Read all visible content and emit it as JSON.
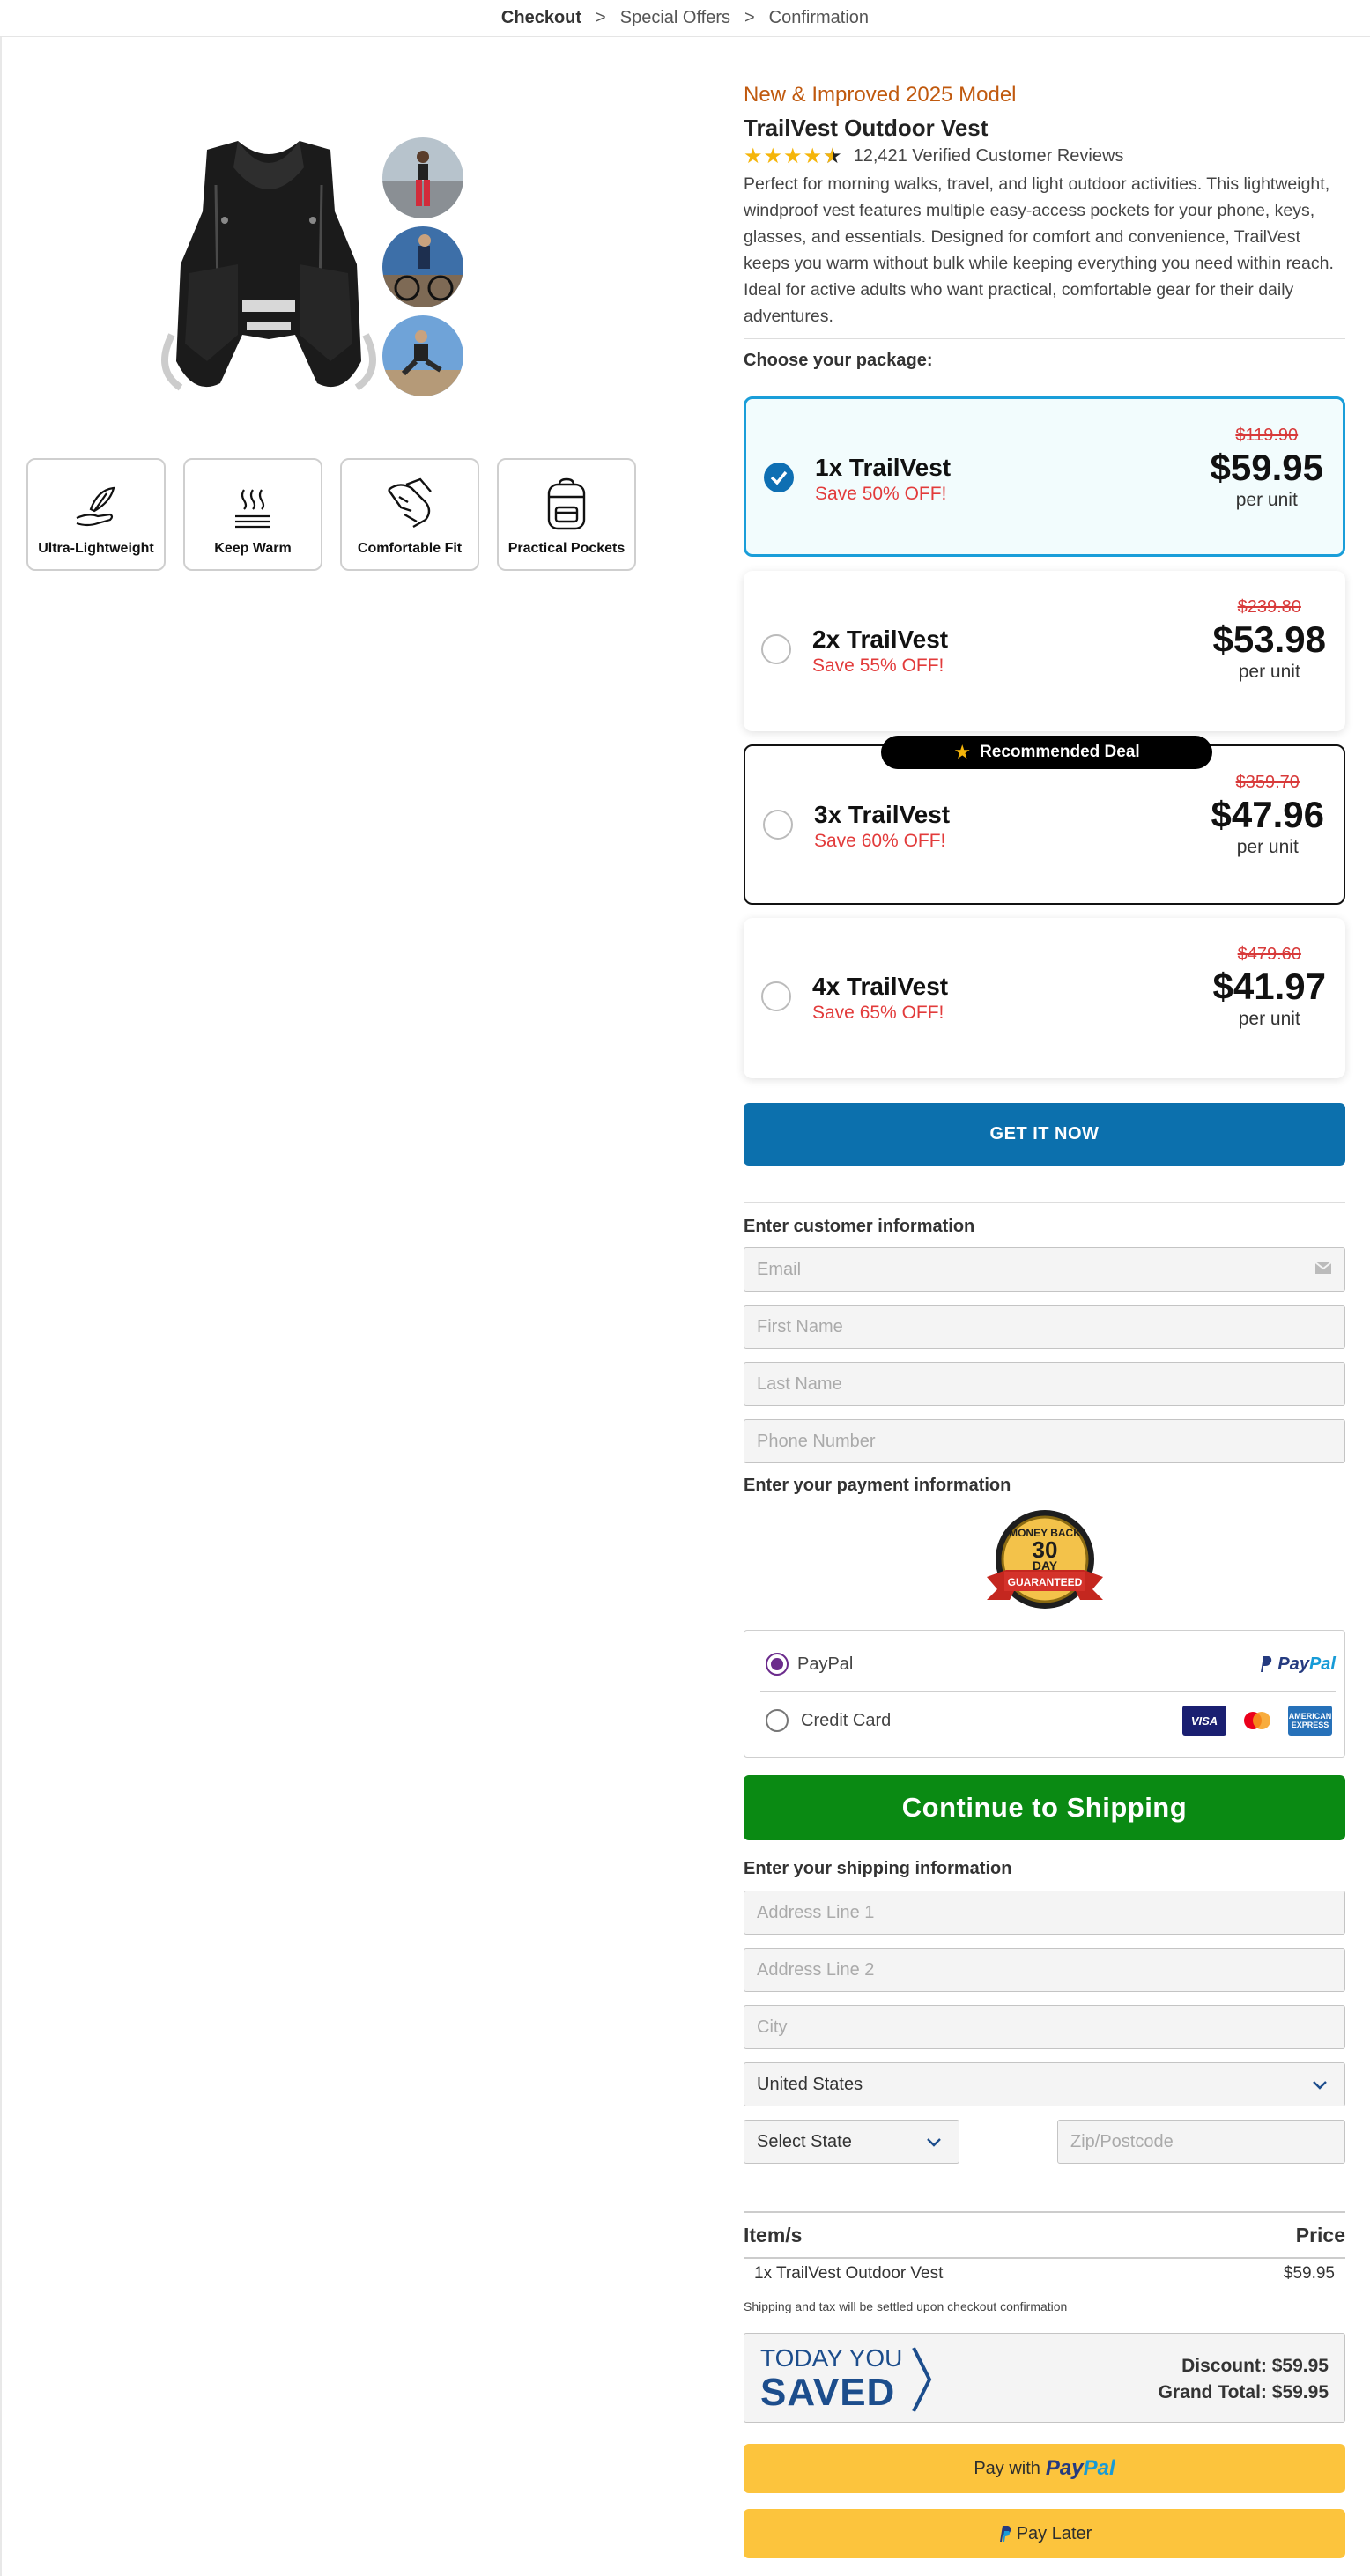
{
  "breadcrumb": {
    "step1": "Checkout",
    "step2": "Special Offers",
    "step3": "Confirmation",
    "separator": ">"
  },
  "features": [
    {
      "label": "Ultra-Lightweight",
      "icon": "feather-hand-icon"
    },
    {
      "label": "Keep Warm",
      "icon": "heat-waves-icon"
    },
    {
      "label": "Comfortable Fit",
      "icon": "arm-flex-icon"
    },
    {
      "label": "Practical Pockets",
      "icon": "backpack-icon"
    }
  ],
  "product": {
    "badge": "New & Improved 2025 Model",
    "title": "TrailVest Outdoor Vest",
    "rating": 4.5,
    "reviews": "12,421 Verified Customer Reviews",
    "description": "Perfect for morning walks, travel, and light outdoor activities. This lightweight, windproof vest features multiple easy-access pockets for your phone, keys, glasses, and essentials. Designed for comfort and convenience, TrailVest keeps you warm without bulk while keeping everything you need within reach. Ideal for active adults who want practical, comfortable gear for their daily adventures."
  },
  "packages": {
    "heading": "Choose your package:",
    "recommended_label": "Recommended Deal",
    "items": [
      {
        "name": "1x TrailVest",
        "save": "Save 50% OFF!",
        "old_price": "$119.90",
        "price": "$59.95",
        "unit": "per unit",
        "selected": true
      },
      {
        "name": "2x TrailVest",
        "save": "Save 55% OFF!",
        "old_price": "$239.80",
        "price": "$53.98",
        "unit": "per unit",
        "selected": false
      },
      {
        "name": "3x TrailVest",
        "save": "Save 60% OFF!",
        "old_price": "$359.70",
        "price": "$47.96",
        "unit": "per unit",
        "selected": false
      },
      {
        "name": "4x TrailVest",
        "save": "Save 65% OFF!",
        "old_price": "$479.60",
        "price": "$41.97",
        "unit": "per unit",
        "selected": false
      }
    ]
  },
  "cta": {
    "label": "GET IT NOW"
  },
  "customer": {
    "heading": "Enter customer information",
    "email_placeholder": "Email",
    "first_name_placeholder": "First Name",
    "last_name_placeholder": "Last Name",
    "phone_placeholder": "Phone Number"
  },
  "payment": {
    "heading": "Enter your payment information",
    "guarantee": {
      "top": "MONEY BACK",
      "number": "30",
      "day": "DAY",
      "ribbon": "GUARANTEED"
    },
    "paypal_label": "PayPal",
    "paypal_logo_1": "Pay",
    "paypal_logo_2": "Pal",
    "card_label": "Credit Card",
    "cards": {
      "visa": "VISA",
      "amex": "AMERICAN EXPRESS"
    }
  },
  "continue_button": "Continue to Shipping",
  "shipping": {
    "heading": "Enter your shipping information",
    "address1_placeholder": "Address Line 1",
    "address2_placeholder": "Address Line 2",
    "city_placeholder": "City",
    "country": "United States",
    "state": "Select State",
    "zip_placeholder": "Zip/Postcode"
  },
  "summary": {
    "col_item": "Item/s",
    "col_price": "Price",
    "line_item": "1x TrailVest Outdoor Vest",
    "line_price": "$59.95",
    "note": "Shipping and tax will be settled upon checkout confirmation",
    "today_you": "TODAY YOU",
    "saved": "SAVED",
    "discount": "Discount: $59.95",
    "grand_total": "Grand Total: $59.95"
  },
  "paypal_buttons": {
    "pay_with": "Pay with",
    "pay_later": "Pay Later",
    "logo_1": "Pay",
    "logo_2": "Pal"
  },
  "colors": {
    "accent": "#0c70ad",
    "selected_border": "#1a9ed9",
    "save_red": "#e23b3b",
    "shipping_green": "#0a8a13",
    "paypal_yellow": "#fcc43d",
    "badge_orange": "#c0590e"
  }
}
